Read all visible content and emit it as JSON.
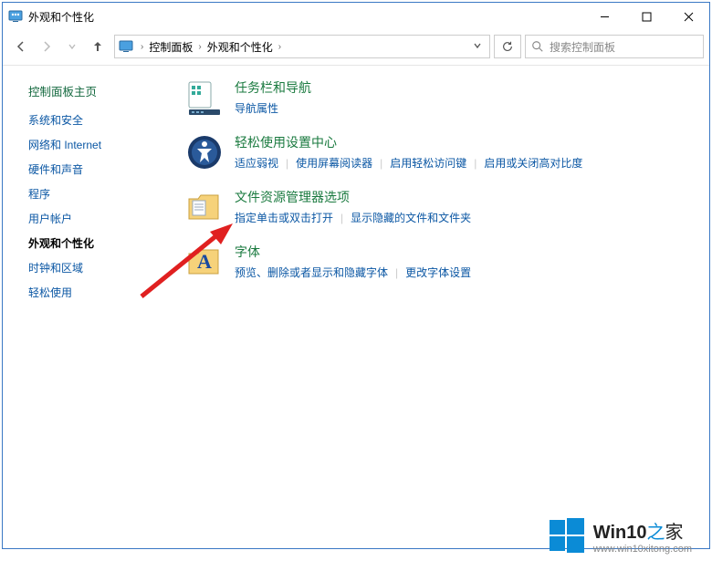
{
  "window": {
    "title": "外观和个性化"
  },
  "breadcrumb": {
    "root_sep": "›",
    "items": [
      "控制面板",
      "外观和个性化"
    ],
    "sep": "›"
  },
  "search": {
    "placeholder": "搜索控制面板"
  },
  "sidebar": {
    "main": "控制面板主页",
    "items": [
      {
        "label": "系统和安全"
      },
      {
        "label": "网络和 Internet"
      },
      {
        "label": "硬件和声音"
      },
      {
        "label": "程序"
      },
      {
        "label": "用户帐户"
      },
      {
        "label": "外观和个性化",
        "current": true
      },
      {
        "label": "时钟和区域"
      },
      {
        "label": "轻松使用"
      }
    ]
  },
  "categories": [
    {
      "title": "任务栏和导航",
      "links": [
        "导航属性"
      ]
    },
    {
      "title": "轻松使用设置中心",
      "links": [
        "适应弱视",
        "使用屏幕阅读器",
        "启用轻松访问键",
        "启用或关闭高对比度"
      ]
    },
    {
      "title": "文件资源管理器选项",
      "links": [
        "指定单击或双击打开",
        "显示隐藏的文件和文件夹"
      ]
    },
    {
      "title": "字体",
      "links": [
        "预览、删除或者显示和隐藏字体",
        "更改字体设置"
      ]
    }
  ],
  "watermark": {
    "brand1": "Win10",
    "brand2": "之",
    "brand3": "家",
    "url": "www.win10xitong.com"
  }
}
